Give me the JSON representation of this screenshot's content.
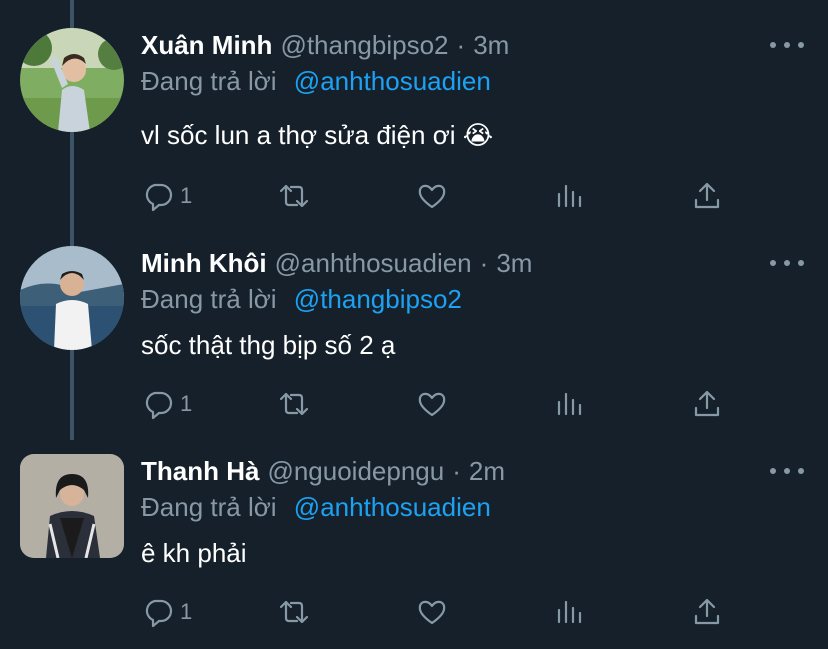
{
  "tweets": [
    {
      "name": "Xuân Minh",
      "handle": "@thangbipso2",
      "separator": "·",
      "time": "3m",
      "reply_label": "Đang trả lời",
      "reply_to": "@anhthosuadien",
      "text": "vl sốc lun a thợ sửa điện ơi 😭",
      "reply_count": "1"
    },
    {
      "name": "Minh Khôi",
      "handle": "@anhthosuadien",
      "separator": "·",
      "time": "3m",
      "reply_label": "Đang trả lời",
      "reply_to": "@thangbipso2",
      "text": "sốc thật thg bịp số 2 ạ",
      "reply_count": "1"
    },
    {
      "name": "Thanh Hà",
      "handle": "@nguoidepngu",
      "separator": "·",
      "time": "2m",
      "reply_label": "Đang trả lời",
      "reply_to": "@anhthosuadien",
      "text": "ê kh phải",
      "reply_count": "1"
    }
  ],
  "colors": {
    "background": "#15202b",
    "secondary_text": "#8899a6",
    "mention": "#1da1f2",
    "thread_line": "#3d5466"
  },
  "icons": [
    "reply-icon",
    "retweet-icon",
    "like-icon",
    "analytics-icon",
    "share-icon",
    "more-icon"
  ]
}
